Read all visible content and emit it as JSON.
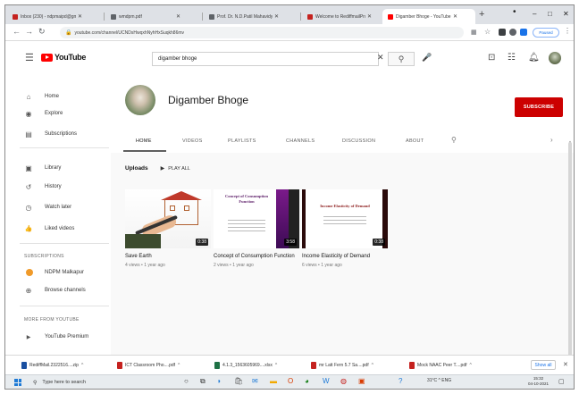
{
  "browser": {
    "tabs": [
      {
        "label": "Inbox (230) - ndpmaipd@gm",
        "favicon_color": "#c5221f",
        "active": false
      },
      {
        "label": "wmdpm.pdf",
        "favicon_color": "#5f6368",
        "active": false
      },
      {
        "label": "Prof. Dr. N.D.Patil Mahavidya",
        "favicon_color": "#5f6368",
        "active": false
      },
      {
        "label": "Welcome to RediffmailPro",
        "favicon_color": "#c5221f",
        "active": false
      },
      {
        "label": "Digamber Bhoge - YouTube",
        "favicon_color": "#ff0000",
        "active": true
      }
    ],
    "new_tab": "+",
    "window_controls": [
      "•",
      "–",
      "□",
      "✕"
    ],
    "url": "youtube.com/channel/UCNDsHwqxhNyhHxSuqkh86mv",
    "paused_label": "Paused"
  },
  "youtube": {
    "logo_text": "YouTube",
    "search_query": "digamber bhoge",
    "sidebar": {
      "main": [
        {
          "label": "Home",
          "icon": "home-icon",
          "glyph": "⌂"
        },
        {
          "label": "Explore",
          "icon": "compass-icon",
          "glyph": "◉"
        },
        {
          "label": "Subscriptions",
          "icon": "subscriptions-icon",
          "glyph": "▤"
        }
      ],
      "library": [
        {
          "label": "Library",
          "icon": "library-icon",
          "glyph": "▣"
        },
        {
          "label": "History",
          "icon": "history-icon",
          "glyph": "↺"
        },
        {
          "label": "Watch later",
          "icon": "clock-icon",
          "glyph": "◷"
        },
        {
          "label": "Liked videos",
          "icon": "thumbs-up-icon",
          "glyph": "👍"
        }
      ],
      "subscriptions_heading": "SUBSCRIPTIONS",
      "subscriptions": [
        {
          "label": "NDPM Malkapur"
        },
        {
          "label": "Browse channels",
          "glyph": "⊕"
        }
      ],
      "more_heading": "MORE FROM YOUTUBE",
      "more": [
        {
          "label": "YouTube Premium",
          "glyph": "▶"
        }
      ]
    },
    "channel": {
      "name": "Digamber Bhoge",
      "subscribe_label": "SUBSCRIBE",
      "tabs": [
        "HOME",
        "VIDEOS",
        "PLAYLISTS",
        "CHANNELS",
        "DISCUSSION",
        "ABOUT"
      ],
      "active_tab": "HOME"
    },
    "uploads": {
      "title": "Uploads",
      "play_all": "PLAY ALL"
    },
    "videos": [
      {
        "title": "Save Earth",
        "meta": "4 views • 1 year ago",
        "duration": "0:38"
      },
      {
        "title": "Concept of Consumption Function",
        "meta": "2 views • 1 year ago",
        "duration": "3:58",
        "thumb_title": "Concept of Consumption Function"
      },
      {
        "title": "Income Elasticity of Demand",
        "meta": "6 views • 1 year ago",
        "duration": "0:38",
        "thumb_title": "Income Elasticity of Demand"
      }
    ]
  },
  "downloads": {
    "items": [
      {
        "label": "RediffMail.2322516....zip",
        "color": "#1a4fa0"
      },
      {
        "label": "ICT Classroom Pho....pdf",
        "color": "#c5221f"
      },
      {
        "label": "4.1.3_1563605969....xlsx",
        "color": "#1e7145"
      },
      {
        "label": "mr Latt Fern 5.7 Sa....pdf",
        "color": "#c5221f"
      },
      {
        "label": "Mock NAAC Peer T....pdf",
        "color": "#c5221f"
      }
    ],
    "show_all": "Show all"
  },
  "taskbar": {
    "search_placeholder": "Type here to search",
    "tray_text": "31°C  ^  ENG",
    "time": "15:32",
    "date": "04-10-2021"
  }
}
